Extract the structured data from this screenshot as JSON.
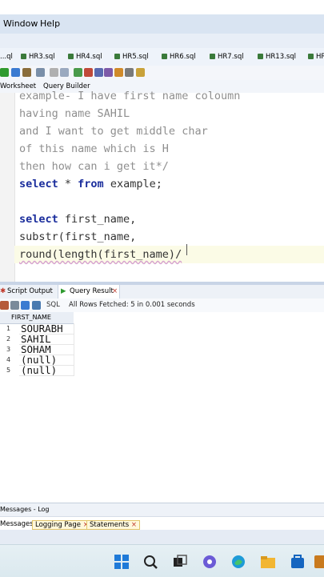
{
  "menubar": {
    "items": [
      "Window",
      "Help"
    ]
  },
  "file_tabs": [
    "...ql",
    "HR3.sql",
    "HR4.sql",
    "HR5.sql",
    "HR6.sql",
    "HR7.sql",
    "HR13.sql",
    "HR"
  ],
  "editor_tabs": {
    "worksheet": "Worksheet",
    "query_builder": "Query Builder"
  },
  "editor": {
    "lines": [
      "example- I have first name coloumn",
      "having name SAHIL",
      "and I want to get middle char",
      "of this name which is H",
      "then how can i get it*/",
      "select",
      " * ",
      "from",
      " example;",
      "select",
      " first_name,",
      "substr(first_name,",
      "round(length(first_name)/"
    ]
  },
  "output_tabs": {
    "script_output": "Script Output",
    "query_result": "Query Result",
    "close": "×"
  },
  "result_toolbar": {
    "sql": "SQL",
    "status": "All Rows Fetched: 5 in 0.001 seconds"
  },
  "grid": {
    "column": "FIRST_NAME",
    "rows": [
      {
        "n": "1",
        "v": "SOURABH"
      },
      {
        "n": "2",
        "v": "SAHIL"
      },
      {
        "n": "3",
        "v": "SOHAM"
      },
      {
        "n": "4",
        "v": "(null)"
      },
      {
        "n": "5",
        "v": "(null)"
      }
    ]
  },
  "messages": {
    "title": "Messages - Log",
    "tabs": [
      "Messages",
      "Logging Page",
      "Statements"
    ],
    "close": "×"
  },
  "colors": {
    "keyword": "#1a2d9c",
    "comment": "#8f8f8f",
    "menubar": "#d9e4f2"
  }
}
